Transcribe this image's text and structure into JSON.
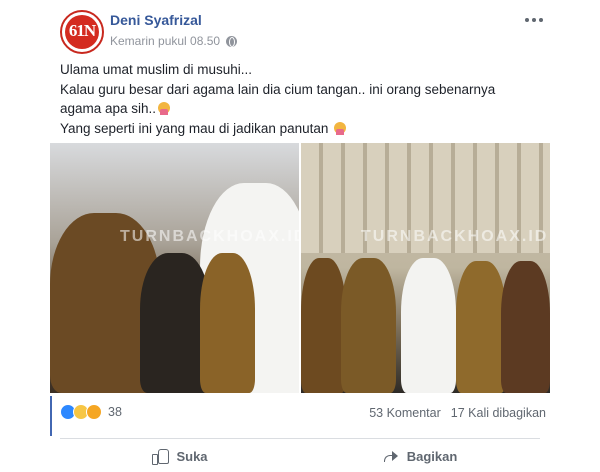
{
  "post": {
    "author_name": "Deni Syafrizal",
    "avatar_text": "61N",
    "timestamp": "Kemarin pukul 08.50",
    "body": [
      "Ulama umat muslim di musuhi...",
      "Kalau guru besar dari agama lain dia cium tangan.. ini orang sebenarnya agama apa sih..",
      "Yang seperti ini yang mau di jadikan panutan"
    ],
    "photo_watermark": "TURNBACKHOAX.ID"
  },
  "engagement": {
    "reaction_count": "38",
    "comments": "53 Komentar",
    "shares": "17 Kali dibagikan"
  },
  "actions": {
    "like_label": "Suka",
    "share_label": "Bagikan"
  },
  "icons": [
    "globe-icon",
    "more-options-icon",
    "like-reaction-icon",
    "haha-reaction-icon",
    "wow-reaction-icon",
    "thumbs-up-icon",
    "share-arrow-icon"
  ],
  "colors": {
    "link": "#365899",
    "secondary_text": "#606770",
    "accent": "#4267b2"
  }
}
